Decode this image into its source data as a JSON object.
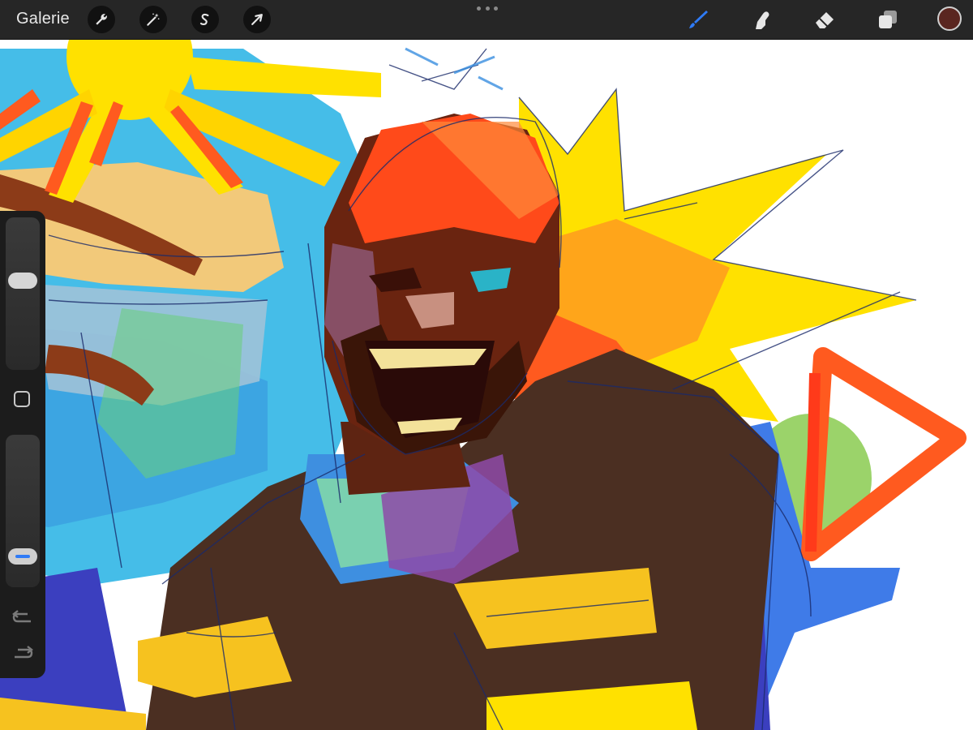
{
  "toolbar": {
    "gallery_label": "Galerie",
    "left_tools": [
      {
        "name": "actions",
        "icon": "wrench-icon"
      },
      {
        "name": "adjustments",
        "icon": "magic-wand-icon"
      },
      {
        "name": "selection",
        "icon": "selection-s-icon"
      },
      {
        "name": "transform",
        "icon": "arrow-cursor-icon"
      }
    ],
    "right_tools": [
      {
        "name": "brush",
        "icon": "brush-icon",
        "active": true
      },
      {
        "name": "smudge",
        "icon": "smudge-finger-icon",
        "active": false
      },
      {
        "name": "eraser",
        "icon": "eraser-icon",
        "active": false
      },
      {
        "name": "layers",
        "icon": "layers-icon",
        "active": false
      }
    ],
    "current_color": "#5a2620",
    "active_tool_color": "#2f7bf6"
  },
  "sidebar": {
    "brush_size_level": 0.6,
    "opacity_level": 0.15,
    "modify_button_icon": "square-outline-icon",
    "undo_icon": "undo-arrow-icon",
    "redo_icon": "redo-arrow-icon"
  },
  "canvas": {
    "subject": "painting-of-shouting-man-with-sun-and-burst",
    "palette": [
      "#ffe100",
      "#ff5a1f",
      "#3ec0e6",
      "#3b3fbf",
      "#4a2a1c",
      "#f4c84a",
      "#7bdc7e"
    ]
  }
}
